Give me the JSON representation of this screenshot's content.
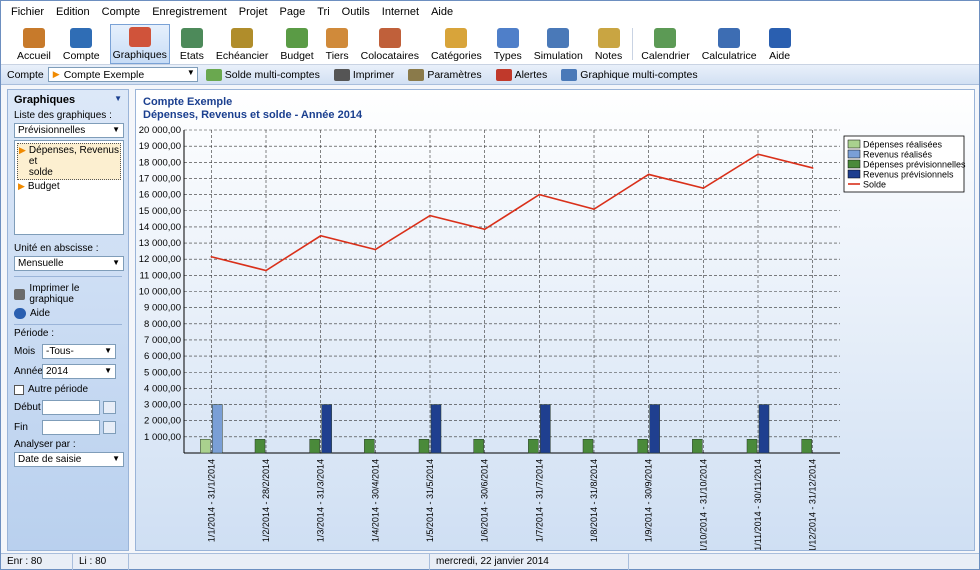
{
  "menu": [
    "Fichier",
    "Edition",
    "Compte",
    "Enregistrement",
    "Projet",
    "Page",
    "Tri",
    "Outils",
    "Internet",
    "Aide"
  ],
  "toolbar": [
    {
      "label": "Accueil",
      "icon": "home-icon",
      "color": "#c77a2b"
    },
    {
      "label": "Compte",
      "icon": "book-icon",
      "color": "#2f6db5"
    },
    {
      "label": "Graphiques",
      "icon": "bar-chart-icon",
      "color": "#d0533a",
      "active": true
    },
    {
      "label": "Etats",
      "icon": "report-icon",
      "color": "#4d8a5a"
    },
    {
      "label": "Echéancier",
      "icon": "clock-icon",
      "color": "#b08d2b"
    },
    {
      "label": "Budget",
      "icon": "money-icon",
      "color": "#5a9b45"
    },
    {
      "label": "Tiers",
      "icon": "person-icon",
      "color": "#d08a3a"
    },
    {
      "label": "Colocataires",
      "icon": "people-icon",
      "color": "#c0603a"
    },
    {
      "label": "Catégories",
      "icon": "category-icon",
      "color": "#d8a43a"
    },
    {
      "label": "Types",
      "icon": "shapes-icon",
      "color": "#4f7fc9"
    },
    {
      "label": "Simulation",
      "icon": "simulation-icon",
      "color": "#4a79b8"
    },
    {
      "label": "Notes",
      "icon": "note-icon",
      "color": "#c9a542"
    },
    {
      "label": "Calendrier",
      "icon": "calendar-icon",
      "color": "#5c9a55"
    },
    {
      "label": "Calculatrice",
      "icon": "calculator-icon",
      "color": "#3d6db3"
    },
    {
      "label": "Aide",
      "icon": "help-icon",
      "color": "#2a5fb0"
    }
  ],
  "accountbar": {
    "label": "Compte",
    "account": "Compte Exemple",
    "actions": [
      {
        "label": "Solde multi-comptes",
        "icon": "multi-balance-icon",
        "color": "#6aa84f"
      },
      {
        "label": "Imprimer",
        "icon": "printer-icon",
        "color": "#555555"
      },
      {
        "label": "Paramètres",
        "icon": "settings-icon",
        "color": "#8a7a4a"
      },
      {
        "label": "Alertes",
        "icon": "alert-icon",
        "color": "#c0392b"
      },
      {
        "label": "Graphique multi-comptes",
        "icon": "multi-chart-icon",
        "color": "#4a79b8"
      }
    ]
  },
  "sidebar": {
    "title": "Graphiques",
    "list_label": "Liste des graphiques :",
    "list_type": "Prévisionnelles",
    "items": [
      {
        "line1": "Dépenses, Revenus et",
        "line2": "solde",
        "selected": true
      },
      {
        "line1": "Budget",
        "line2": "",
        "selected": false
      }
    ],
    "abscissa_label": "Unité en abscisse :",
    "abscissa_value": "Mensuelle",
    "print_label": "Imprimer le graphique",
    "help_label": "Aide",
    "period_label": "Période :",
    "month_label": "Mois",
    "month_value": "-Tous-",
    "year_label": "Année",
    "year_value": "2014",
    "other_period": "Autre période",
    "start_label": "Début",
    "end_label": "Fin",
    "analyse_label": "Analyser par :",
    "analyse_value": "Date de saisie"
  },
  "chart_data": {
    "type": "bar",
    "title": "Compte Exemple",
    "subtitle": "Dépenses, Revenus et solde - Année 2014",
    "categories": [
      "1/1/2014 - 31/1/2014",
      "1/2/2014 - 28/2/2014",
      "1/3/2014 - 31/3/2014",
      "1/4/2014 - 30/4/2014",
      "1/5/2014 - 31/5/2014",
      "1/6/2014 - 30/6/2014",
      "1/7/2014 - 31/7/2014",
      "1/8/2014 - 31/8/2014",
      "1/9/2014 - 30/9/2014",
      "1/10/2014 - 31/10/2014",
      "1/11/2014 - 30/11/2014",
      "1/12/2014 - 31/12/2014"
    ],
    "ylim": [
      0,
      20000
    ],
    "ytick_step": 1000,
    "yticks": [
      "1 000,00",
      "2 000,00",
      "3 000,00",
      "4 000,00",
      "5 000,00",
      "6 000,00",
      "7 000,00",
      "8 000,00",
      "9 000,00",
      "10 000,00",
      "11 000,00",
      "12 000,00",
      "13 000,00",
      "14 000,00",
      "15 000,00",
      "16 000,00",
      "17 000,00",
      "18 000,00",
      "19 000,00",
      "20 000,00"
    ],
    "grid": true,
    "legend": "top-right",
    "series": [
      {
        "name": "Dépenses réalisées",
        "kind": "bar",
        "color": "#a9d18e",
        "values": [
          850,
          0,
          0,
          0,
          0,
          0,
          0,
          0,
          0,
          0,
          0,
          0
        ]
      },
      {
        "name": "Revenus réalisés",
        "kind": "bar",
        "color": "#7a9fd6",
        "values": [
          3000,
          0,
          0,
          0,
          0,
          0,
          0,
          0,
          0,
          0,
          0,
          0
        ]
      },
      {
        "name": "Dépenses prévisionnelles",
        "kind": "bar",
        "color": "#4a8a3a",
        "values": [
          0,
          850,
          850,
          850,
          850,
          850,
          850,
          850,
          850,
          850,
          850,
          850
        ]
      },
      {
        "name": "Revenus prévisionnels",
        "kind": "bar",
        "color": "#1f3f8f",
        "values": [
          0,
          0,
          3000,
          0,
          3000,
          0,
          3000,
          0,
          3000,
          0,
          3000,
          0
        ]
      },
      {
        "name": "Solde",
        "kind": "line",
        "color": "#d9301a",
        "values": [
          12150,
          11300,
          13450,
          12600,
          14700,
          13850,
          16000,
          15100,
          17250,
          16400,
          18500,
          17650
        ]
      }
    ]
  },
  "status": {
    "records": "Enr : 80",
    "lines": "Li : 80",
    "date": "mercredi, 22 janvier 2014"
  }
}
